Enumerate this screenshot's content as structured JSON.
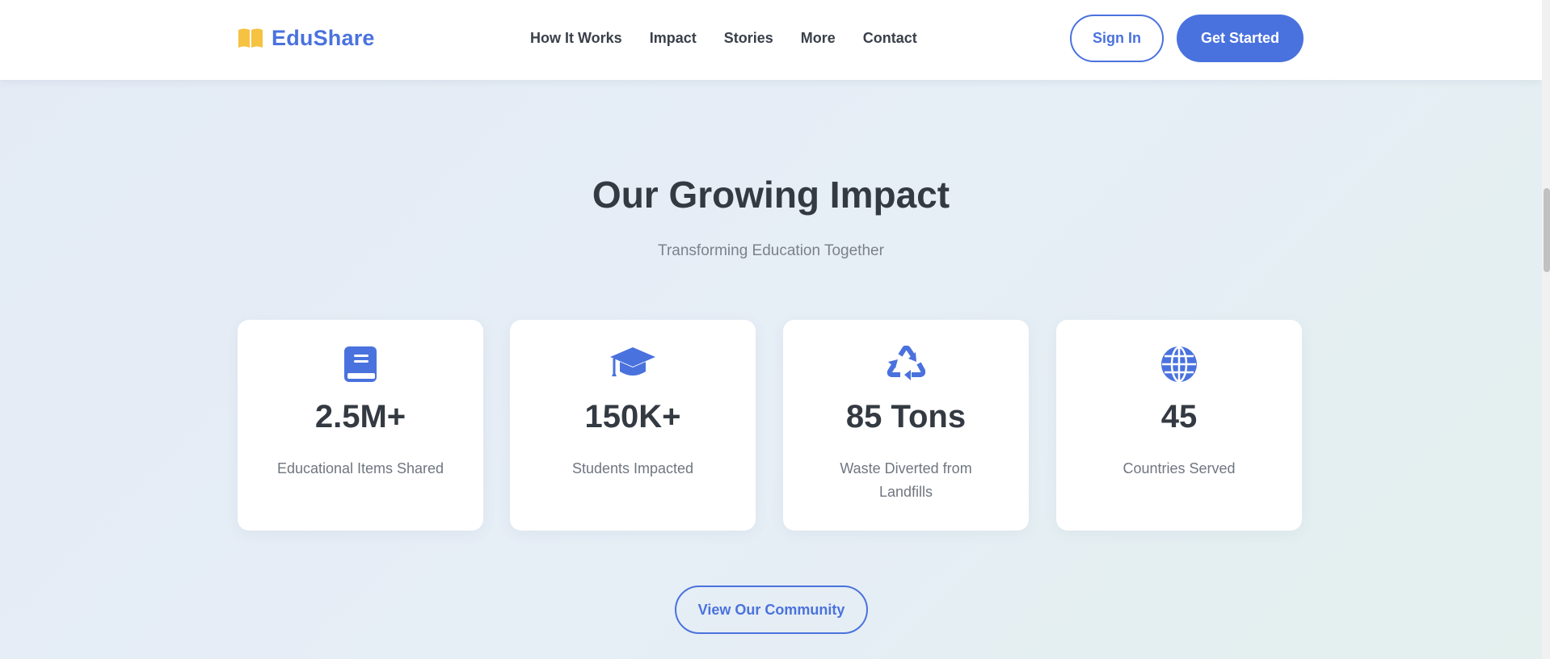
{
  "header": {
    "logo_text": "EduShare",
    "nav": [
      "How It Works",
      "Impact",
      "Stories",
      "More",
      "Contact"
    ],
    "signin_label": "Sign In",
    "get_started_label": "Get Started"
  },
  "impact": {
    "title": "Our Growing Impact",
    "subtitle": "Transforming Education Together",
    "stats": [
      {
        "icon": "book-icon",
        "value": "2.5M+",
        "label": "Educational Items Shared"
      },
      {
        "icon": "graduation-cap-icon",
        "value": "150K+",
        "label": "Students Impacted"
      },
      {
        "icon": "recycle-icon",
        "value": "85 Tons",
        "label": "Waste Diverted from Landfills"
      },
      {
        "icon": "globe-icon",
        "value": "45",
        "label": "Countries Served"
      }
    ],
    "cta_label": "View Our Community"
  },
  "colors": {
    "accent": "#4a72de",
    "logo_icon": "#f5c242",
    "heading": "#343a42",
    "muted": "#7b828c"
  }
}
